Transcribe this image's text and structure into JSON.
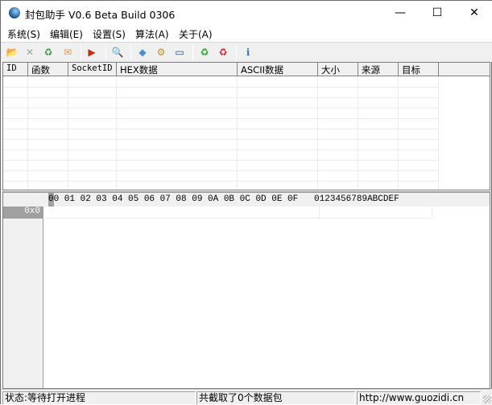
{
  "window": {
    "title": "封包助手 V0.6 Beta Build 0306",
    "minimize": "—",
    "maximize": "☐",
    "close": "✕"
  },
  "menu": [
    "系统(S)",
    "编辑(E)",
    "设置(S)",
    "算法(A)",
    "关于(A)"
  ],
  "toolbar": [
    {
      "icon": "open-folder-icon",
      "glyph": "📂",
      "color": "#e8c050"
    },
    {
      "icon": "stop-icon",
      "glyph": "✕",
      "color": "#a0a0a0"
    },
    {
      "icon": "recycle-bin-icon",
      "glyph": "♻",
      "color": "#3a9a3a"
    },
    {
      "icon": "mail-icon",
      "glyph": "✉",
      "color": "#e0a040"
    },
    {
      "icon": "play-icon",
      "glyph": "▶",
      "color": "#c03010"
    },
    {
      "icon": "search-icon",
      "glyph": "🔍",
      "color": "#808080"
    },
    {
      "icon": "network-icon",
      "glyph": "◆",
      "color": "#4a90d0"
    },
    {
      "icon": "filter-icon",
      "glyph": "⚙",
      "color": "#c09020"
    },
    {
      "icon": "window-icon",
      "glyph": "▭",
      "color": "#205090"
    },
    {
      "icon": "green-recycle-icon",
      "glyph": "♻",
      "color": "#20a020"
    },
    {
      "icon": "red-recycle-icon",
      "glyph": "♻",
      "color": "#d02020"
    },
    {
      "icon": "info-icon",
      "glyph": "ℹ",
      "color": "#4070b0"
    }
  ],
  "columns": [
    "ID",
    "函数",
    "SocketID",
    "HEX数据",
    "ASCII数据",
    "大小",
    "来源",
    "目标"
  ],
  "hex": {
    "header": "00 01 02 03 04 05 06 07 08 09 0A 0B 0C 0D 0E 0F   0123456789ABCDEF",
    "row_address": "0x0"
  },
  "status": {
    "state": "状态:等待打开进程",
    "count": "共截取了0个数据包",
    "url": "http://www.guozidi.cn"
  }
}
